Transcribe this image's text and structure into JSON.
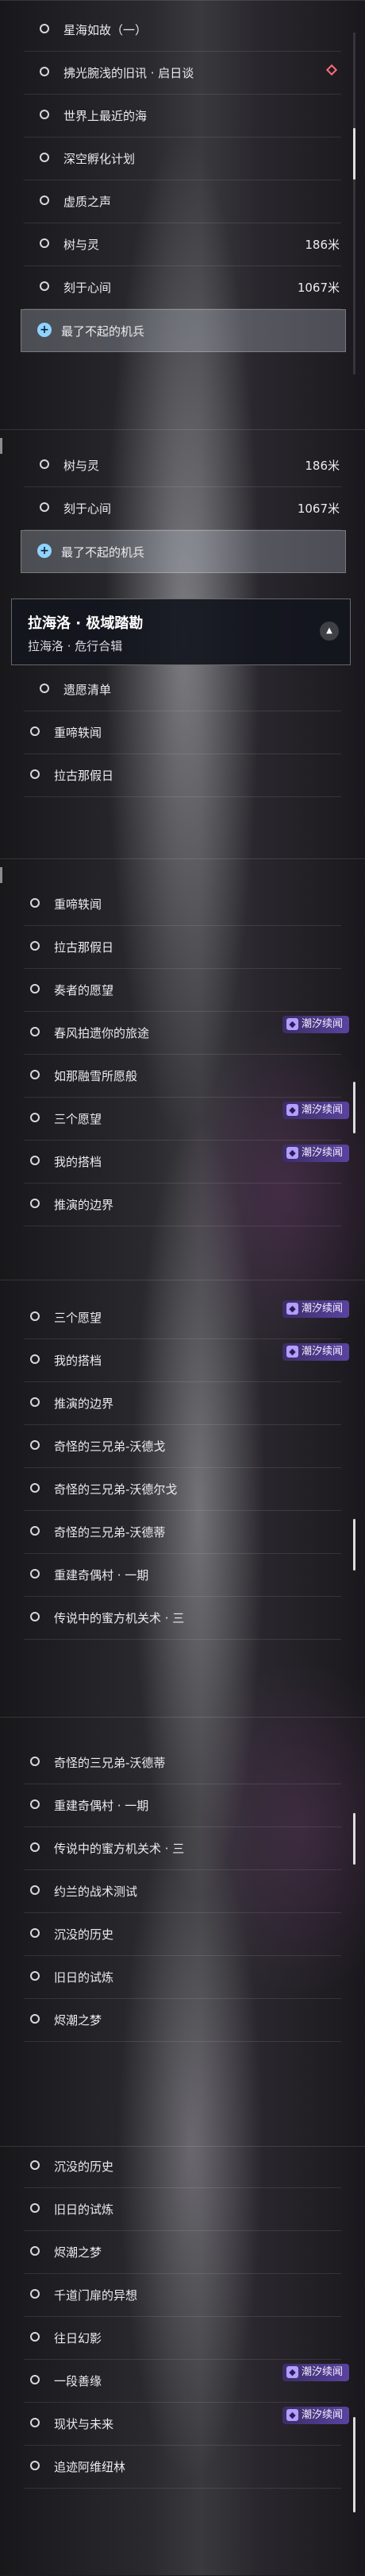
{
  "panel1": {
    "rows": [
      {
        "label": "星海如故（一）",
        "dist": ""
      },
      {
        "label": "拂光腕浅的旧讯 · 启日谈",
        "dist": ""
      },
      {
        "label": "世界上最近的海",
        "dist": ""
      },
      {
        "label": "深空孵化计划",
        "dist": ""
      },
      {
        "label": "虚质之声",
        "dist": ""
      },
      {
        "label": "树与灵",
        "dist": "186米"
      },
      {
        "label": "刻于心间",
        "dist": "1067米"
      }
    ],
    "active": {
      "label": "最了不起的机兵"
    }
  },
  "panel2": {
    "rows": [
      {
        "label": "树与灵",
        "dist": "186米"
      },
      {
        "label": "刻于心间",
        "dist": "1067米"
      }
    ],
    "active": {
      "label": "最了不起的机兵"
    },
    "header": {
      "title": "拉海洛 · 极域踏勘",
      "subtitle": "拉海洛 · 危行合辑"
    },
    "after": [
      {
        "label": "遗愿清单"
      },
      {
        "label": "重啼轶闻"
      },
      {
        "label": "拉古那假日"
      }
    ]
  },
  "panel3": {
    "rows": [
      {
        "label": "重啼轶闻",
        "badge": ""
      },
      {
        "label": "拉古那假日",
        "badge": ""
      },
      {
        "label": "奏者的愿望",
        "badge": ""
      },
      {
        "label": "春风拍遗你的旅途",
        "badge": "潮汐续闻"
      },
      {
        "label": "如那融雪所愿般",
        "badge": ""
      },
      {
        "label": "三个愿望",
        "badge": "潮汐续闻"
      },
      {
        "label": "我的搭档",
        "badge": "潮汐续闻"
      },
      {
        "label": "推演的边界",
        "badge": ""
      }
    ]
  },
  "panel4": {
    "rows": [
      {
        "label": "三个愿望",
        "badge": "潮汐续闻"
      },
      {
        "label": "我的搭档",
        "badge": "潮汐续闻"
      },
      {
        "label": "推演的边界",
        "badge": ""
      },
      {
        "label": "奇怪的三兄弟-沃德戈",
        "badge": ""
      },
      {
        "label": "奇怪的三兄弟-沃德尔戈",
        "badge": ""
      },
      {
        "label": "奇怪的三兄弟-沃德蒂",
        "badge": ""
      },
      {
        "label": "重建奇偶村 · 一期",
        "badge": ""
      },
      {
        "label": "传说中的蜜方机关术 · 三",
        "badge": ""
      }
    ]
  },
  "panel5": {
    "rows": [
      {
        "label": "奇怪的三兄弟-沃德蒂"
      },
      {
        "label": "重建奇偶村 · 一期"
      },
      {
        "label": "传说中的蜜方机关术 · 三"
      },
      {
        "label": "约兰的战术测试"
      },
      {
        "label": "沉没的历史"
      },
      {
        "label": "旧日的试炼"
      },
      {
        "label": "烬潮之梦"
      }
    ]
  },
  "panel6": {
    "rows": [
      {
        "label": "沉没的历史",
        "badge": ""
      },
      {
        "label": "旧日的试炼",
        "badge": ""
      },
      {
        "label": "烬潮之梦",
        "badge": ""
      },
      {
        "label": "千道门扉的异想",
        "badge": ""
      },
      {
        "label": "往日幻影",
        "badge": ""
      },
      {
        "label": "一段善缘",
        "badge": "潮汐续闻"
      },
      {
        "label": "现状与未来",
        "badge": "潮汐续闻"
      },
      {
        "label": "追迹阿维纽林",
        "badge": ""
      }
    ]
  }
}
